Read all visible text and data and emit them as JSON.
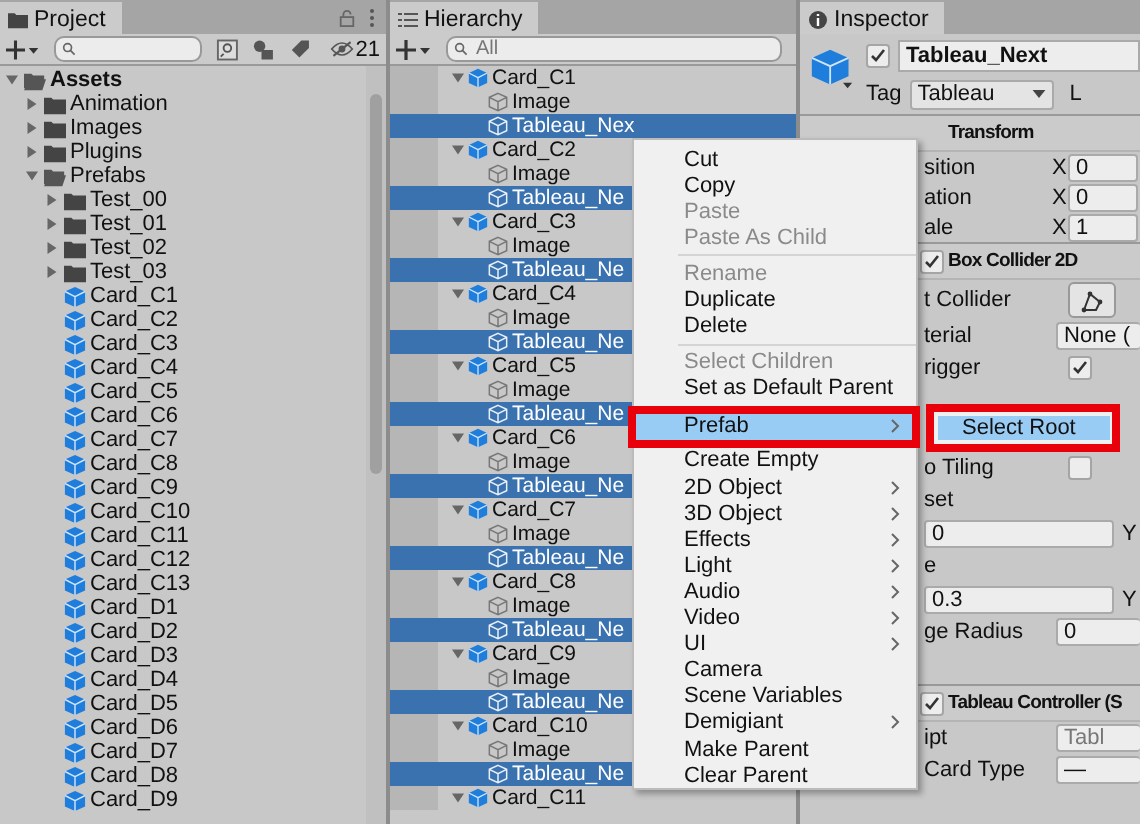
{
  "project": {
    "tab": "Project",
    "hidden_count": "21",
    "tree": [
      {
        "name": "Assets",
        "kind": "folder",
        "expanded": true,
        "children": [
          {
            "name": "Animation",
            "kind": "folder",
            "expanded": false
          },
          {
            "name": "Images",
            "kind": "folder",
            "expanded": false
          },
          {
            "name": "Plugins",
            "kind": "folder",
            "expanded": false
          },
          {
            "name": "Prefabs",
            "kind": "folder",
            "expanded": true,
            "children": [
              {
                "name": "Test_00",
                "kind": "folder",
                "expanded": false
              },
              {
                "name": "Test_01",
                "kind": "folder",
                "expanded": false
              },
              {
                "name": "Test_02",
                "kind": "folder",
                "expanded": false
              },
              {
                "name": "Test_03",
                "kind": "folder",
                "expanded": false
              },
              {
                "name": "Card_C1",
                "kind": "prefab"
              },
              {
                "name": "Card_C2",
                "kind": "prefab"
              },
              {
                "name": "Card_C3",
                "kind": "prefab"
              },
              {
                "name": "Card_C4",
                "kind": "prefab"
              },
              {
                "name": "Card_C5",
                "kind": "prefab"
              },
              {
                "name": "Card_C6",
                "kind": "prefab"
              },
              {
                "name": "Card_C7",
                "kind": "prefab"
              },
              {
                "name": "Card_C8",
                "kind": "prefab"
              },
              {
                "name": "Card_C9",
                "kind": "prefab"
              },
              {
                "name": "Card_C10",
                "kind": "prefab"
              },
              {
                "name": "Card_C11",
                "kind": "prefab"
              },
              {
                "name": "Card_C12",
                "kind": "prefab"
              },
              {
                "name": "Card_C13",
                "kind": "prefab"
              },
              {
                "name": "Card_D1",
                "kind": "prefab"
              },
              {
                "name": "Card_D2",
                "kind": "prefab"
              },
              {
                "name": "Card_D3",
                "kind": "prefab"
              },
              {
                "name": "Card_D4",
                "kind": "prefab"
              },
              {
                "name": "Card_D5",
                "kind": "prefab"
              },
              {
                "name": "Card_D6",
                "kind": "prefab"
              },
              {
                "name": "Card_D7",
                "kind": "prefab"
              },
              {
                "name": "Card_D8",
                "kind": "prefab"
              },
              {
                "name": "Card_D9",
                "kind": "prefab"
              }
            ]
          }
        ]
      }
    ]
  },
  "hierarchy": {
    "tab": "Hierarchy",
    "search": {
      "placeholder": "All"
    },
    "items": [
      {
        "name": "Card_C1",
        "kind": "prefab",
        "expanded": true,
        "selected": false,
        "children": [
          {
            "name": "Image",
            "kind": "object",
            "selected": false
          },
          {
            "name": "Tableau_Nex",
            "kind": "object",
            "selected": true
          }
        ]
      },
      {
        "name": "Card_C2",
        "kind": "prefab",
        "expanded": true,
        "selected": false,
        "children": [
          {
            "name": "Image",
            "kind": "object",
            "selected": false
          },
          {
            "name": "Tableau_Ne",
            "kind": "object",
            "selected": true
          }
        ]
      },
      {
        "name": "Card_C3",
        "kind": "prefab",
        "expanded": true,
        "selected": false,
        "children": [
          {
            "name": "Image",
            "kind": "object",
            "selected": false
          },
          {
            "name": "Tableau_Ne",
            "kind": "object",
            "selected": true
          }
        ]
      },
      {
        "name": "Card_C4",
        "kind": "prefab",
        "expanded": true,
        "selected": false,
        "children": [
          {
            "name": "Image",
            "kind": "object",
            "selected": false
          },
          {
            "name": "Tableau_Ne",
            "kind": "object",
            "selected": true
          }
        ]
      },
      {
        "name": "Card_C5",
        "kind": "prefab",
        "expanded": true,
        "selected": false,
        "children": [
          {
            "name": "Image",
            "kind": "object",
            "selected": false
          },
          {
            "name": "Tableau_Ne",
            "kind": "object",
            "selected": true
          }
        ]
      },
      {
        "name": "Card_C6",
        "kind": "prefab",
        "expanded": true,
        "selected": false,
        "children": [
          {
            "name": "Image",
            "kind": "object",
            "selected": false
          },
          {
            "name": "Tableau_Ne",
            "kind": "object",
            "selected": true
          }
        ]
      },
      {
        "name": "Card_C7",
        "kind": "prefab",
        "expanded": true,
        "selected": false,
        "children": [
          {
            "name": "Image",
            "kind": "object",
            "selected": false
          },
          {
            "name": "Tableau_Ne",
            "kind": "object",
            "selected": true
          }
        ]
      },
      {
        "name": "Card_C8",
        "kind": "prefab",
        "expanded": true,
        "selected": false,
        "children": [
          {
            "name": "Image",
            "kind": "object",
            "selected": false
          },
          {
            "name": "Tableau_Ne",
            "kind": "object",
            "selected": true
          }
        ]
      },
      {
        "name": "Card_C9",
        "kind": "prefab",
        "expanded": true,
        "selected": false,
        "children": [
          {
            "name": "Image",
            "kind": "object",
            "selected": false
          },
          {
            "name": "Tableau_Ne",
            "kind": "object",
            "selected": true
          }
        ]
      },
      {
        "name": "Card_C10",
        "kind": "prefab",
        "expanded": true,
        "selected": false,
        "children": [
          {
            "name": "Image",
            "kind": "object",
            "selected": false
          },
          {
            "name": "Tableau_Ne",
            "kind": "object",
            "selected": true
          }
        ]
      },
      {
        "name": "Card_C11",
        "kind": "prefab",
        "expanded": true,
        "selected": false
      }
    ]
  },
  "context_menu": {
    "items": [
      {
        "kind": "item",
        "label": "Cut",
        "disabled": false,
        "submenu": false,
        "selected": false
      },
      {
        "kind": "item",
        "label": "Copy",
        "disabled": false,
        "submenu": false,
        "selected": false
      },
      {
        "kind": "item",
        "label": "Paste",
        "disabled": true,
        "submenu": false,
        "selected": false
      },
      {
        "kind": "item",
        "label": "Paste As Child",
        "disabled": true,
        "submenu": false,
        "selected": false
      },
      {
        "kind": "separator"
      },
      {
        "kind": "item",
        "label": "Rename",
        "disabled": true,
        "submenu": false,
        "selected": false
      },
      {
        "kind": "item",
        "label": "Duplicate",
        "disabled": false,
        "submenu": false,
        "selected": false
      },
      {
        "kind": "item",
        "label": "Delete",
        "disabled": false,
        "submenu": false,
        "selected": false
      },
      {
        "kind": "separator"
      },
      {
        "kind": "item",
        "label": "Select Children",
        "disabled": true,
        "submenu": false,
        "selected": false
      },
      {
        "kind": "item",
        "label": "Set as Default Parent",
        "disabled": false,
        "submenu": false,
        "selected": false
      },
      {
        "kind": "item",
        "label": "Prefab",
        "disabled": false,
        "submenu": true,
        "selected": true
      },
      {
        "kind": "item",
        "label": "Create Empty",
        "disabled": false,
        "submenu": false,
        "selected": false
      },
      {
        "kind": "item",
        "label": "2D Object",
        "disabled": false,
        "submenu": true,
        "selected": false
      },
      {
        "kind": "item",
        "label": "3D Object",
        "disabled": false,
        "submenu": true,
        "selected": false
      },
      {
        "kind": "item",
        "label": "Effects",
        "disabled": false,
        "submenu": true,
        "selected": false
      },
      {
        "kind": "item",
        "label": "Light",
        "disabled": false,
        "submenu": true,
        "selected": false
      },
      {
        "kind": "item",
        "label": "Audio",
        "disabled": false,
        "submenu": true,
        "selected": false
      },
      {
        "kind": "item",
        "label": "Video",
        "disabled": false,
        "submenu": true,
        "selected": false
      },
      {
        "kind": "item",
        "label": "UI",
        "disabled": false,
        "submenu": true,
        "selected": false
      },
      {
        "kind": "item",
        "label": "Camera",
        "disabled": false,
        "submenu": false,
        "selected": false
      },
      {
        "kind": "item",
        "label": "Scene Variables",
        "disabled": false,
        "submenu": false,
        "selected": false
      },
      {
        "kind": "item",
        "label": "Demigiant",
        "disabled": false,
        "submenu": true,
        "selected": false
      },
      {
        "kind": "item",
        "label": "Make Parent",
        "disabled": false,
        "submenu": false,
        "selected": false
      },
      {
        "kind": "item",
        "label": "Clear Parent",
        "disabled": false,
        "submenu": false,
        "selected": false
      }
    ],
    "submenu": {
      "items": [
        {
          "label": "Select Root",
          "selected": true
        }
      ]
    }
  },
  "inspector": {
    "tab": "Inspector",
    "object": {
      "active": true,
      "name": "Tableau_Next",
      "tag_label": "Tag",
      "tag": "Tableau",
      "layer_label": "L"
    },
    "components": [
      {
        "kind": "fixed",
        "title": "Transform",
        "rows": [
          {
            "kind": "vector",
            "label": "sition",
            "axis": "X",
            "value": "0"
          },
          {
            "kind": "vector",
            "label": "ation",
            "axis": "X",
            "value": "0"
          },
          {
            "kind": "vector",
            "label": "ale",
            "axis": "X",
            "value": "1"
          }
        ]
      },
      {
        "kind": "toggleable",
        "enabled": true,
        "title": "Box Collider 2D",
        "rows": [
          {
            "kind": "button",
            "label": "t Collider"
          },
          {
            "kind": "field",
            "label": "terial",
            "value": "None (",
            "disabled": false
          },
          {
            "kind": "toggle",
            "label": "rigger",
            "checked": true
          },
          {
            "kind": "toggle",
            "label": "o Tiling",
            "checked": false
          },
          {
            "kind": "heading",
            "label": "set"
          },
          {
            "kind": "xy",
            "value": "0",
            "axis": "Y"
          },
          {
            "kind": "heading",
            "label": "e"
          },
          {
            "kind": "xy",
            "value": "0.3",
            "axis": "Y"
          },
          {
            "kind": "field",
            "label": "ge Radius",
            "value": "0",
            "disabled": false
          }
        ]
      },
      {
        "kind": "toggleable",
        "enabled": true,
        "title": "Tableau Controller (S",
        "rows": [
          {
            "kind": "field",
            "label": "ipt",
            "value": "Tabl",
            "disabled": true
          },
          {
            "kind": "field",
            "label": "Card Type",
            "value": "—",
            "disabled": false
          }
        ]
      }
    ]
  }
}
